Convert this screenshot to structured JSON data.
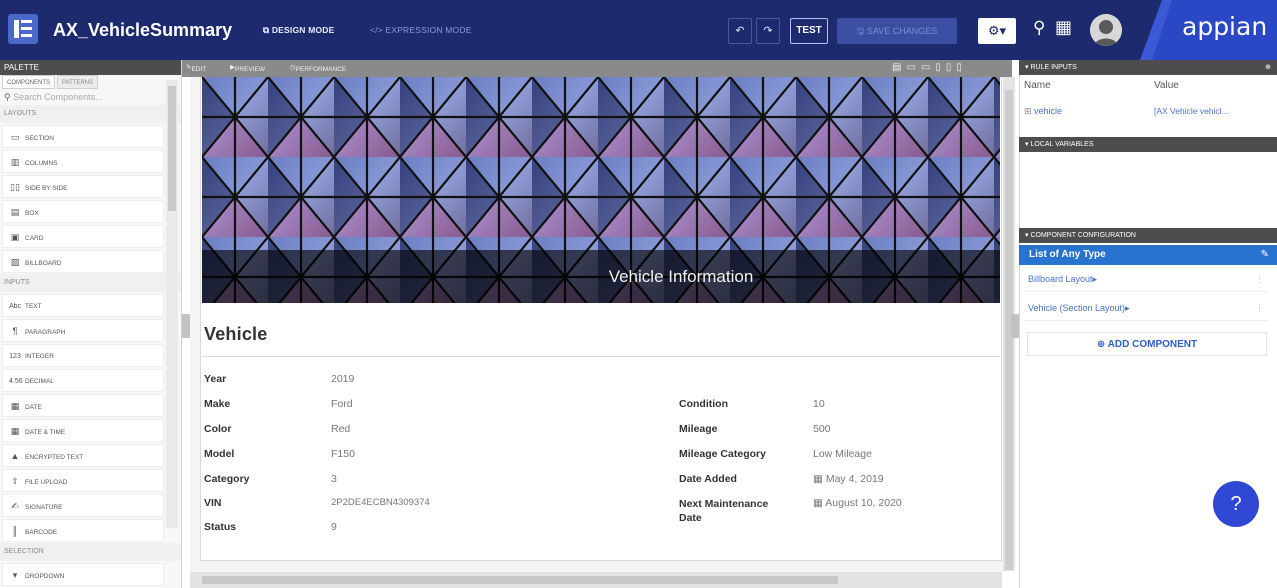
{
  "header": {
    "title": "AX_VehicleSummary",
    "design_mode": "DESIGN MODE",
    "expression_mode": "EXPRESSION MODE",
    "test_label": "TEST",
    "save_label": "SAVE CHANGES",
    "logo_text": "appian"
  },
  "palette": {
    "title": "PALETTE",
    "tabs": [
      "COMPONENTS",
      "PATTERNS"
    ],
    "search_placeholder": "Search Components...",
    "sections": {
      "layouts": "LAYOUTS",
      "inputs": "INPUTS",
      "selection": "SELECTION"
    },
    "layout_items": [
      "SECTION",
      "COLUMNS",
      "SIDE BY SIDE",
      "BOX",
      "CARD",
      "BILLBOARD"
    ],
    "input_items": [
      "TEXT",
      "PARAGRAPH",
      "INTEGER",
      "DECIMAL",
      "DATE",
      "DATE & TIME",
      "ENCRYPTED TEXT",
      "FILE UPLOAD",
      "SIGNATURE",
      "BARCODE"
    ],
    "selection_items": [
      "DROPDOWN"
    ]
  },
  "editor": {
    "tabs": [
      "EDIT",
      "PREVIEW",
      "PERFORMANCE"
    ],
    "banner_title": "Vehicle Information",
    "section_title": "Vehicle",
    "left_fields": [
      {
        "label": "Year",
        "value": "2019"
      },
      {
        "label": "Make",
        "value": "Ford"
      },
      {
        "label": "Color",
        "value": "Red"
      },
      {
        "label": "Model",
        "value": "F150"
      },
      {
        "label": "Category",
        "value": "3"
      },
      {
        "label": "VIN",
        "value": "2P2DE4ECBN4309374"
      },
      {
        "label": "Status",
        "value": "9"
      }
    ],
    "right_fields": [
      {
        "label": "Condition",
        "value": "10"
      },
      {
        "label": "Mileage",
        "value": "500"
      },
      {
        "label": "Mileage Category",
        "value": "Low Mileage"
      },
      {
        "label": "Date Added",
        "value": "May 4, 2019"
      },
      {
        "label": "Next Maintenance Date",
        "value": "August 10, 2020"
      }
    ]
  },
  "rule_inputs": {
    "title": "RULE INPUTS",
    "name_col": "Name",
    "value_col": "Value",
    "row_name": "vehicle",
    "row_value": "[AX Vehicle vehicl..."
  },
  "local_variables": {
    "title": "LOCAL VARIABLES"
  },
  "component_configuration": {
    "title": "COMPONENT CONFIGURATION",
    "selected": "List of Any Type",
    "items": [
      "Billboard Layout",
      "Vehicle (Section Layout)"
    ],
    "add_label": "ADD COMPONENT"
  },
  "colors": {
    "topbar": "#1d2a6e",
    "accent": "#2873d0",
    "help": "#2f47d3"
  }
}
